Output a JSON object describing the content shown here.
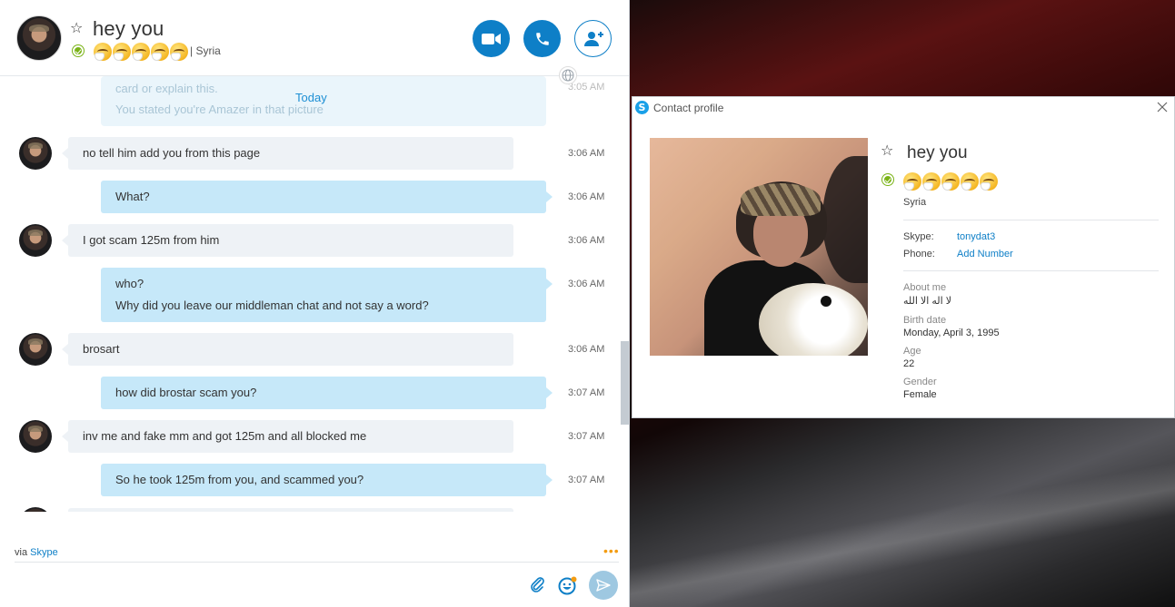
{
  "chat": {
    "contact_name": "hey you",
    "location": "| Syria",
    "mood_emoji_count": 5,
    "ghost": {
      "line1": "card or explain this.",
      "line2": "You stated you're Amazer in that picture",
      "time": "3:05 AM"
    },
    "today_label": "Today",
    "messages": [
      {
        "from": "them",
        "lines": [
          "no tell him add you from this page"
        ],
        "time": "3:06 AM"
      },
      {
        "from": "me",
        "lines": [
          "What?"
        ],
        "time": "3:06 AM"
      },
      {
        "from": "them",
        "lines": [
          "I got scam 125m from him"
        ],
        "time": "3:06 AM"
      },
      {
        "from": "me",
        "lines": [
          "who?",
          "Why did you leave our middleman chat and not say a word?"
        ],
        "time": "3:06 AM"
      },
      {
        "from": "them",
        "lines": [
          "brosart"
        ],
        "time": "3:06 AM"
      },
      {
        "from": "me",
        "lines": [
          "how did brostar scam you?"
        ],
        "time": "3:07 AM"
      },
      {
        "from": "them",
        "lines": [
          "inv me and fake mm and got 125m and all blocked me"
        ],
        "time": "3:07 AM"
      },
      {
        "from": "me",
        "lines": [
          "So he took 125m from you, and scammed you?"
        ],
        "time": "3:07 AM"
      }
    ],
    "footer": {
      "via_prefix": "via",
      "via_brand": "Skype",
      "more_dots": "•••"
    }
  },
  "profile": {
    "window_title": "Contact profile",
    "name": "hey you",
    "location": "Syria",
    "skype_label": "Skype:",
    "skype_value": "tonydat3",
    "phone_label": "Phone:",
    "phone_value": "Add Number",
    "about_label": "About me",
    "about_value": "لا اله الا الله",
    "birth_label": "Birth date",
    "birth_value": "Monday, April 3, 1995",
    "age_label": "Age",
    "age_value": "22",
    "gender_label": "Gender",
    "gender_value": "Female"
  },
  "colors": {
    "skype_blue": "#0e7fc7",
    "online_green": "#7ab317",
    "bubble_me": "#c6e8f9",
    "bubble_them": "#eef2f6"
  }
}
